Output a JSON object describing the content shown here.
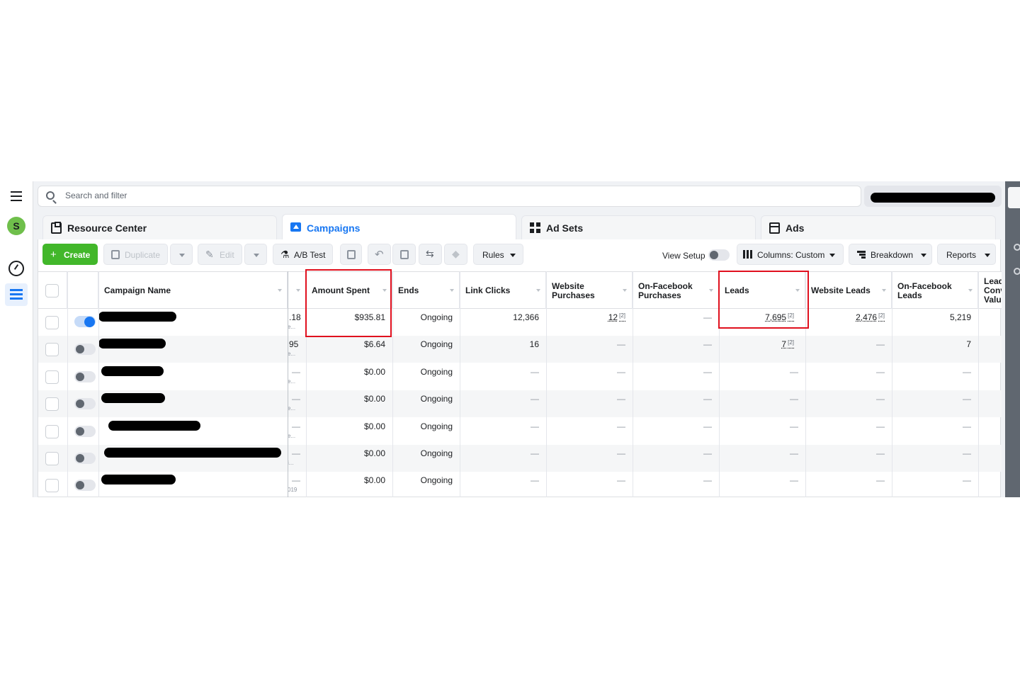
{
  "rail": {
    "avatar_letter": "S"
  },
  "search": {
    "placeholder": "Search and filter"
  },
  "tabs": [
    {
      "label": "Resource Center",
      "icon": "clipboard-icon"
    },
    {
      "label": "Campaigns",
      "icon": "folder-icon"
    },
    {
      "label": "Ad Sets",
      "icon": "grid-icon"
    },
    {
      "label": "Ads",
      "icon": "ad-icon"
    }
  ],
  "toolbar": {
    "create": "Create",
    "duplicate": "Duplicate",
    "edit": "Edit",
    "ab_test": "A/B Test",
    "rules": "Rules",
    "view_setup": "View Setup",
    "columns": "Columns: Custom",
    "breakdown": "Breakdown",
    "reports": "Reports"
  },
  "columns": {
    "campaign_name": "Campaign Name",
    "amount_spent": "Amount Spent",
    "ends": "Ends",
    "link_clicks": "Link Clicks",
    "website_purchases": [
      "Website",
      "Purchases"
    ],
    "on_fb_purchases": [
      "On-Facebook",
      "Purchases"
    ],
    "leads": "Leads",
    "website_leads": "Website Leads",
    "on_fb_leads": [
      "On-Facebook",
      "Leads"
    ],
    "lead_conv": [
      "Lead",
      "Conv",
      "Valu"
    ]
  },
  "rows": [
    {
      "on": true,
      "prev": ".18",
      "prev2": "e...",
      "amount": "$935.81",
      "ends": "Ongoing",
      "clicks": "12,366",
      "web_purch": "12",
      "fb_purch": "—",
      "leads": "7,695",
      "web_leads": "2,476",
      "fb_leads": "5,219"
    },
    {
      "on": false,
      "prev": "95",
      "prev2": "e...",
      "amount": "$6.64",
      "ends": "Ongoing",
      "clicks": "16",
      "web_purch": "—",
      "fb_purch": "—",
      "leads": "7",
      "web_leads": "—",
      "fb_leads": "7"
    },
    {
      "on": false,
      "prev": "—",
      "prev2": "e...",
      "amount": "$0.00",
      "ends": "Ongoing",
      "clicks": "—",
      "web_purch": "—",
      "fb_purch": "—",
      "leads": "—",
      "web_leads": "—",
      "fb_leads": "—"
    },
    {
      "on": false,
      "prev": "—",
      "prev2": "e...",
      "amount": "$0.00",
      "ends": "Ongoing",
      "clicks": "—",
      "web_purch": "—",
      "fb_purch": "—",
      "leads": "—",
      "web_leads": "—",
      "fb_leads": "—"
    },
    {
      "on": false,
      "prev": "—",
      "prev2": "e...",
      "amount": "$0.00",
      "ends": "Ongoing",
      "clicks": "—",
      "web_purch": "—",
      "fb_purch": "—",
      "leads": "—",
      "web_leads": "—",
      "fb_leads": "—"
    },
    {
      "on": false,
      "prev": "—",
      "prev2": "i...",
      "amount": "$0.00",
      "ends": "Ongoing",
      "clicks": "—",
      "web_purch": "—",
      "fb_purch": "—",
      "leads": "—",
      "web_leads": "—",
      "fb_leads": "—"
    },
    {
      "on": false,
      "prev": "—",
      "prev2": "019",
      "amount": "$0.00",
      "ends": "Ongoing",
      "clicks": "—",
      "web_purch": "—",
      "fb_purch": "—",
      "leads": "—",
      "web_leads": "—",
      "fb_leads": "—"
    }
  ],
  "footnote_mark": "[2]",
  "colors": {
    "accent": "#1877f2",
    "create": "#42b72a",
    "highlight": "#e0101e"
  }
}
